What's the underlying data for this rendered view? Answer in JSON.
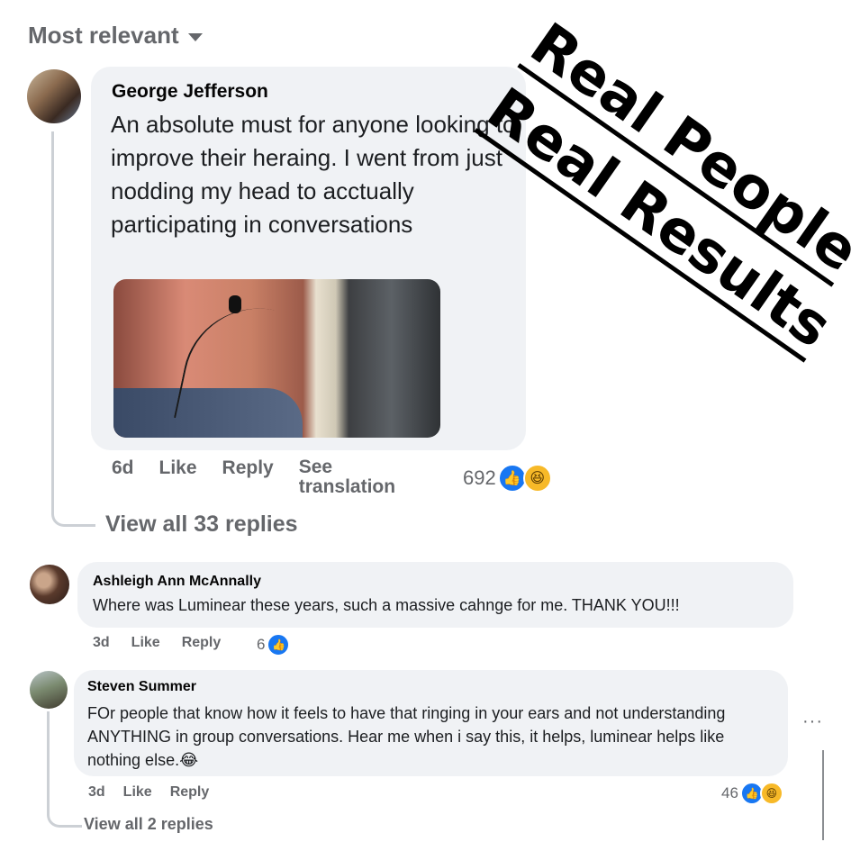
{
  "sort": {
    "label": "Most relevant"
  },
  "overlay": {
    "line1": "Real People",
    "line2": "Real Results"
  },
  "comments": [
    {
      "author": "George Jefferson",
      "text": "An absolute must for anyone looking to improve their heraing. I went from just nodding my head to acctually participating in conversations",
      "time": "6d",
      "like_label": "Like",
      "reply_label": "Reply",
      "translate_label": "See translation",
      "reaction_count": "692",
      "view_replies": "View all 33 replies"
    },
    {
      "author": "Ashleigh Ann McAnnally",
      "text": "Where was Luminear these years, such a massive cahnge for me. THANK YOU!!!",
      "time": "3d",
      "like_label": "Like",
      "reply_label": "Reply",
      "reaction_count": "6"
    },
    {
      "author": "Steven Summer",
      "text": "FOr people that know how it feels to have that ringing in your ears and not understanding ANYTHING in group conversations. Hear me when i say this, it helps, luminear helps like nothing else.😂",
      "time": "3d",
      "like_label": "Like",
      "reply_label": "Reply",
      "reaction_count": "46",
      "view_replies": "View all 2 replies"
    }
  ],
  "more_options": "···",
  "icons": {
    "like": "👍",
    "haha": "😆"
  }
}
